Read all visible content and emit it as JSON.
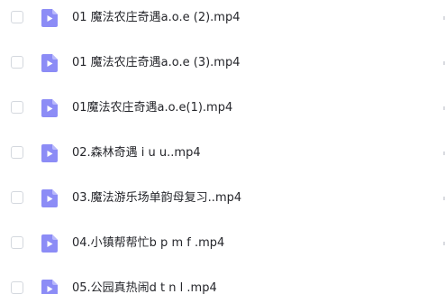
{
  "files": [
    {
      "name": "01 魔法农庄奇遇a.o.e (2).mp4"
    },
    {
      "name": "01 魔法农庄奇遇a.o.e (3).mp4"
    },
    {
      "name": "01魔法农庄奇遇a.o.e(1).mp4"
    },
    {
      "name": "02.森林奇遇 i u u..mp4"
    },
    {
      "name": "03.魔法游乐场单韵母复习..mp4"
    },
    {
      "name": "04.小镇帮帮忙b p m f .mp4"
    },
    {
      "name": "05.公园真热闹d t n l .mp4"
    }
  ],
  "icons": {
    "row_checkbox": "checkbox-icon",
    "file_type": "video-file-icon"
  },
  "colors": {
    "video_icon": "#8c8cf6",
    "video_icon_fold": "#b9b9fb",
    "text": "#25262b",
    "checkbox_border": "#d4d8de"
  }
}
